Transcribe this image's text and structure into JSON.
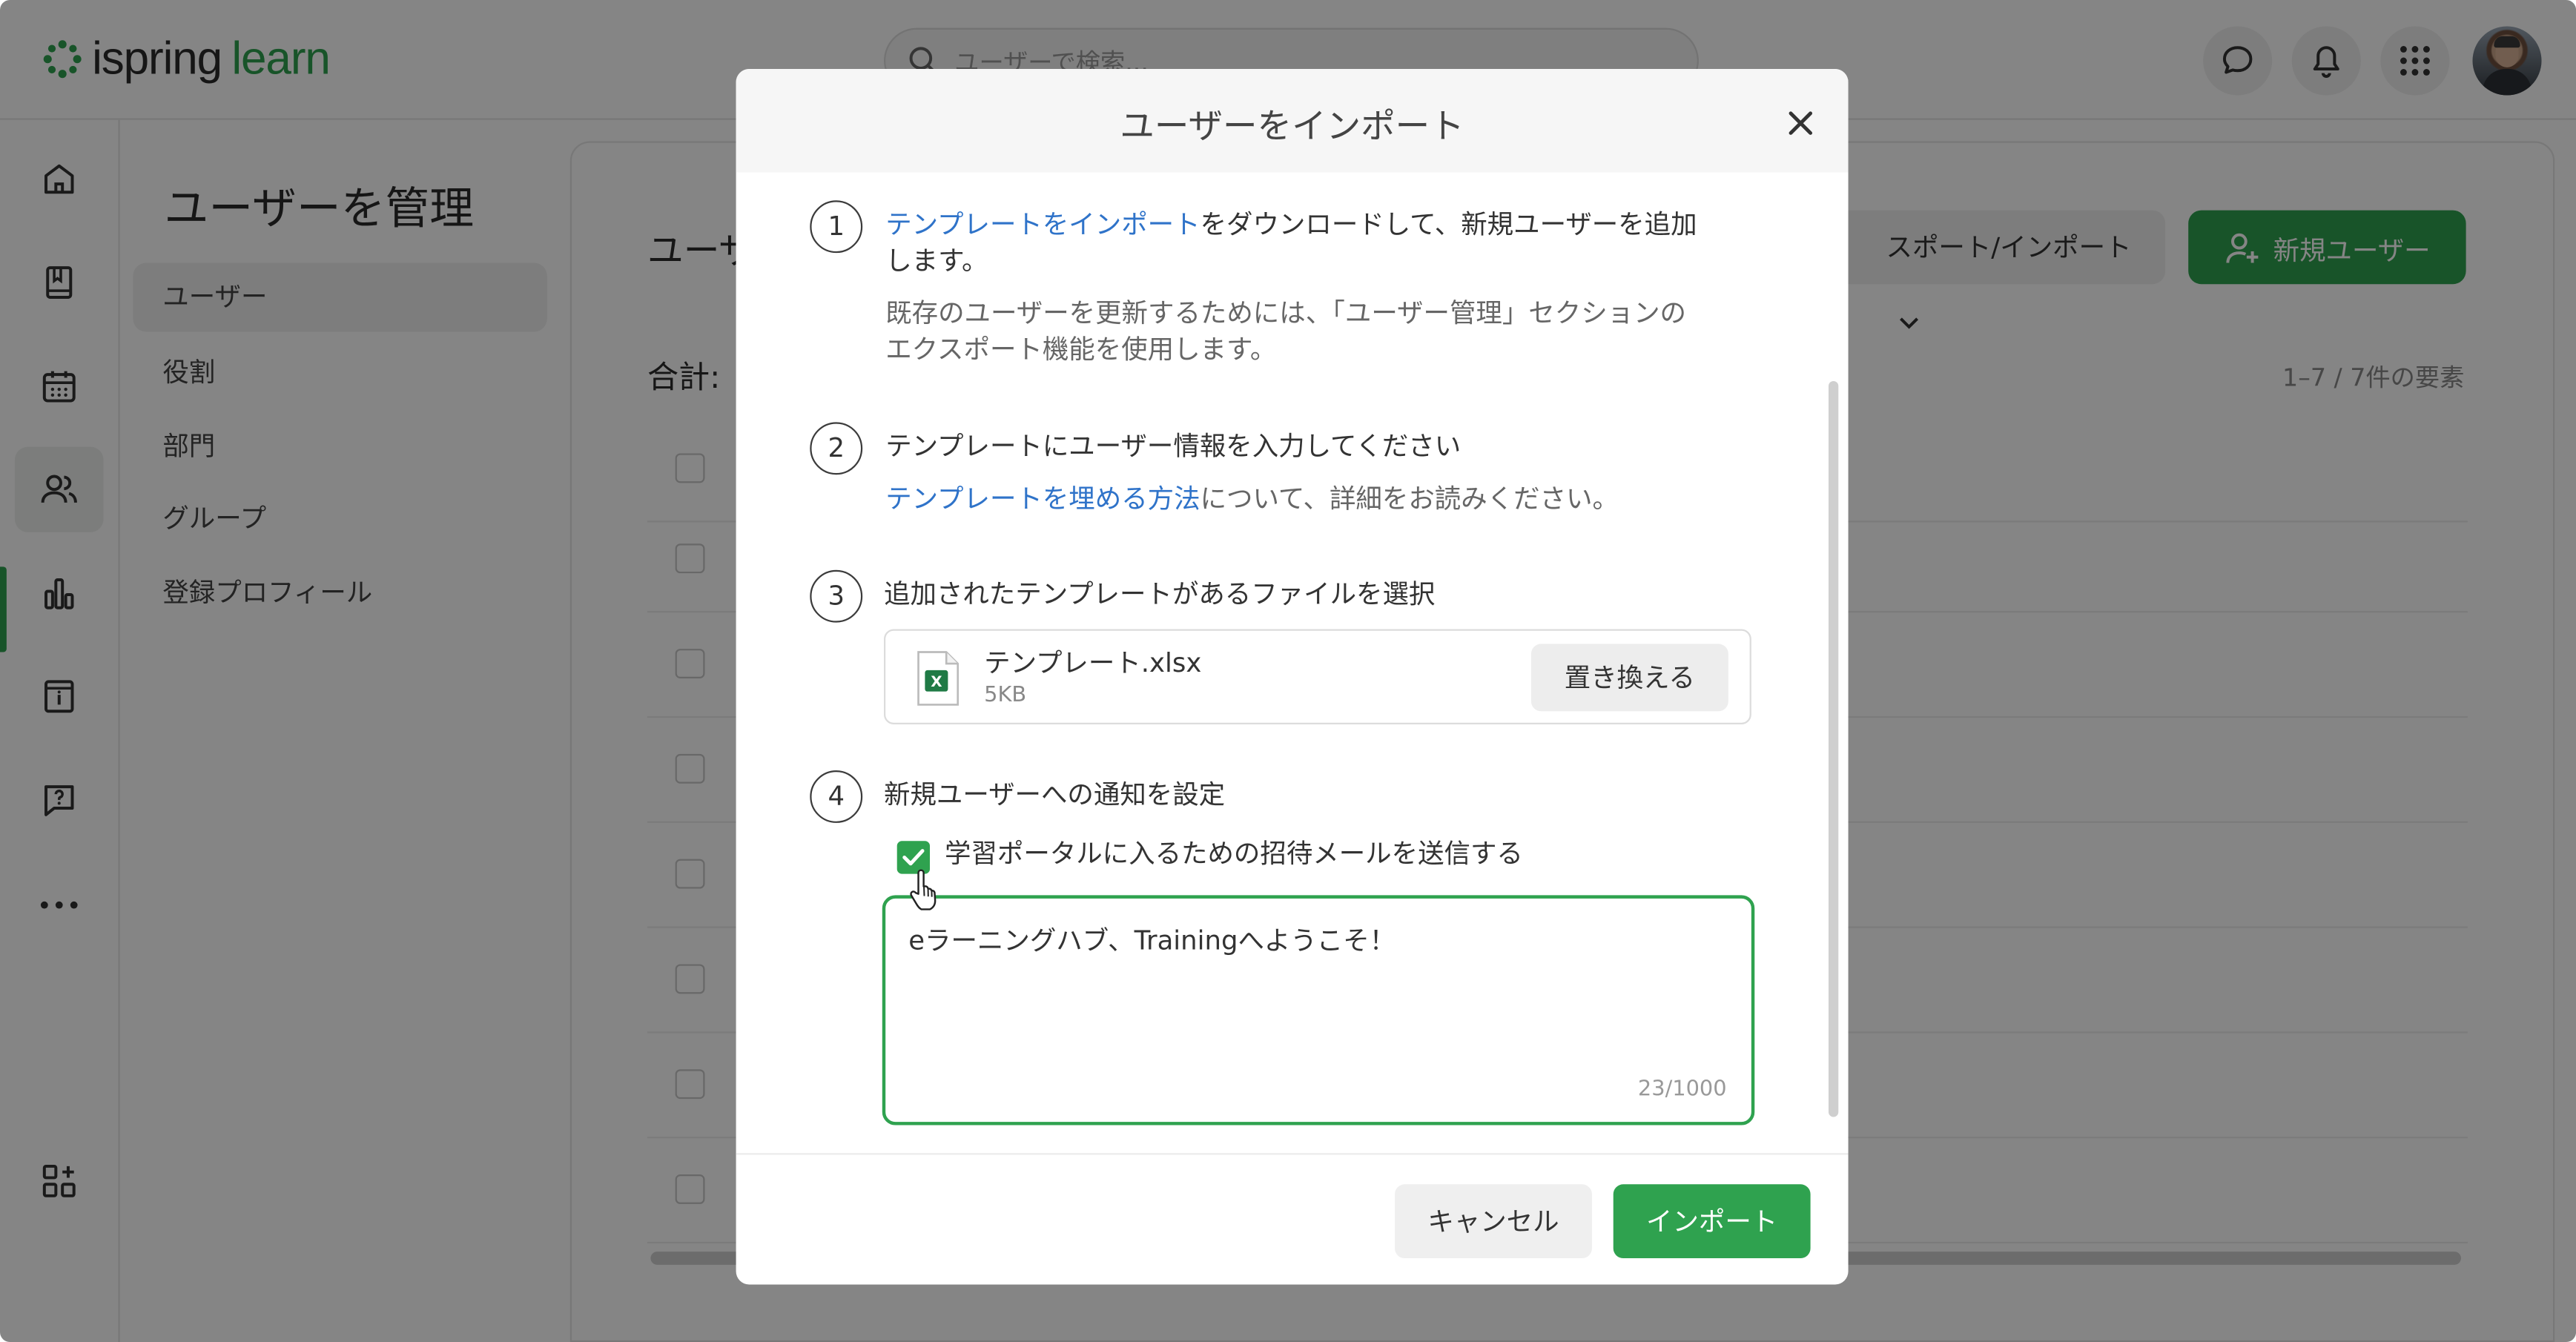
{
  "app": {
    "logo_text_a": "ispring",
    "logo_text_b": "learn",
    "search_placeholder": "ユーザーで検索...",
    "brand_color": "#2fa24f"
  },
  "sidebar": {
    "title": "ユーザーを管理",
    "items": [
      {
        "label": "ユーザー",
        "active": true
      },
      {
        "label": "役割"
      },
      {
        "label": "部門"
      },
      {
        "label": "グループ"
      },
      {
        "label": "登録プロフィール"
      }
    ]
  },
  "main": {
    "title": "ユーザ",
    "total_label": "合計:",
    "export_import_label": "スポート/インポート",
    "new_user_label": "新規ユーザー",
    "count_label": "1–7 / 7件の要素"
  },
  "modal": {
    "title": "ユーザーをインポート",
    "step1": {
      "num": "1",
      "link": "テンプレートをインポート",
      "text_rest_line1": "をダウンロードして、新規ユーザーを追加",
      "text_line2": "します。",
      "sub_line1": "既存のユーザーを更新するためには、「ユーザー管理」セクションの",
      "sub_line2": "エクスポート機能を使用します。"
    },
    "step2": {
      "num": "2",
      "text": "テンプレートにユーザー情報を入力してください",
      "link": "テンプレートを埋める方法",
      "sub_rest": "について、詳細をお読みください。"
    },
    "step3": {
      "num": "3",
      "text": "追加されたテンプレートがあるファイルを選択",
      "file_name": "テンプレート.xlsx",
      "file_size": "5KB",
      "replace_label": "置き換える"
    },
    "step4": {
      "num": "4",
      "text": "新規ユーザーへの通知を設定",
      "checkbox_label": "学習ポータルに入るための招待メールを送信する",
      "checkbox_checked": true,
      "message": "eラーニングハブ、Trainingへようこそ！",
      "counter": "23/1000"
    },
    "cancel_label": "キャンセル",
    "import_label": "インポート"
  }
}
